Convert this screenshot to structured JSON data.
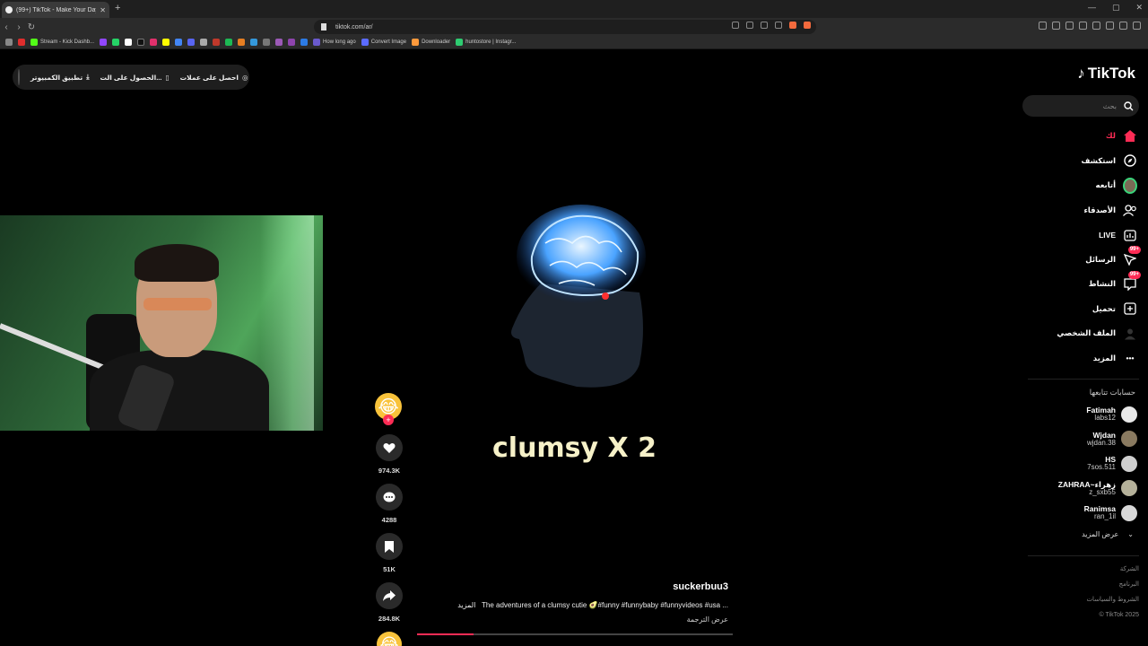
{
  "browser": {
    "tab_title": "(99+) TikTok - Make Your Day",
    "new_tab": "+",
    "url": "tiktok.com/ar/",
    "window_controls": [
      "—",
      "▢",
      "✕"
    ],
    "bookmarks": [
      {
        "label": "Stream - Kick Dashb...",
        "color": "#53fc18"
      },
      {
        "label": "How long ago",
        "color": "#6a5acd"
      },
      {
        "label": "Convert Image",
        "color": "#5b6bff"
      },
      {
        "label": "Downloader",
        "color": "#ff9a3c"
      },
      {
        "label": "huntostore | Instagr...",
        "color": "#2ecc71"
      }
    ]
  },
  "top_bar": {
    "get_coins": "احصل على عملات",
    "get_on_pc": "الحصول على الت...",
    "pc_app": "تطبيق الكمبيوتر"
  },
  "video": {
    "caption_text": "clumsy X 2",
    "author": "suckerbuu3",
    "description": "The adventures of a clumsy cutie 🥑#funny #funnybaby #funnyvideos #usa ...",
    "more_label": "المزيد",
    "translate": "عرض الترجمة",
    "progress": 0.18
  },
  "actions": {
    "likes": "974.3K",
    "comments": "4288",
    "saves": "51K",
    "shares": "284.8K"
  },
  "sidebar": {
    "logo": "TikTok",
    "search_placeholder": "بحث",
    "nav": [
      {
        "label": "لك",
        "icon": "home-icon",
        "active": true
      },
      {
        "label": "استكشف",
        "icon": "compass-icon"
      },
      {
        "label": "أتابعه",
        "icon": "avatar-icon"
      },
      {
        "label": "الأصدقاء",
        "icon": "friends-icon"
      },
      {
        "label": "LIVE",
        "icon": "live-icon"
      },
      {
        "label": "الرسائل",
        "icon": "messages-icon",
        "badge": "99+"
      },
      {
        "label": "النشاط",
        "icon": "activity-icon",
        "badge": "99+"
      },
      {
        "label": "تحميل",
        "icon": "upload-icon"
      },
      {
        "label": "الملف الشخصي",
        "icon": "profile-icon"
      },
      {
        "label": "المزيد",
        "icon": "more-icon"
      }
    ],
    "following_title": "حسابات تتابعها",
    "accounts": [
      {
        "name": "Fatimah",
        "user": "labs12"
      },
      {
        "name": "Wjdan",
        "user": "wjdan.38"
      },
      {
        "name": "HS",
        "user": "7sos.511"
      },
      {
        "name": "ZAHRAA~زهراء",
        "user": "z_sxb55"
      },
      {
        "name": "Ranimsa",
        "user": "ran_1il"
      }
    ],
    "see_more": "عرض المزيد",
    "footer": [
      "الشركة",
      "البرنامج",
      "الشروط والسياسات",
      "© TikTok 2025"
    ]
  },
  "colors": {
    "accent": "#fe2c55",
    "caption": "#f6f1c8"
  }
}
